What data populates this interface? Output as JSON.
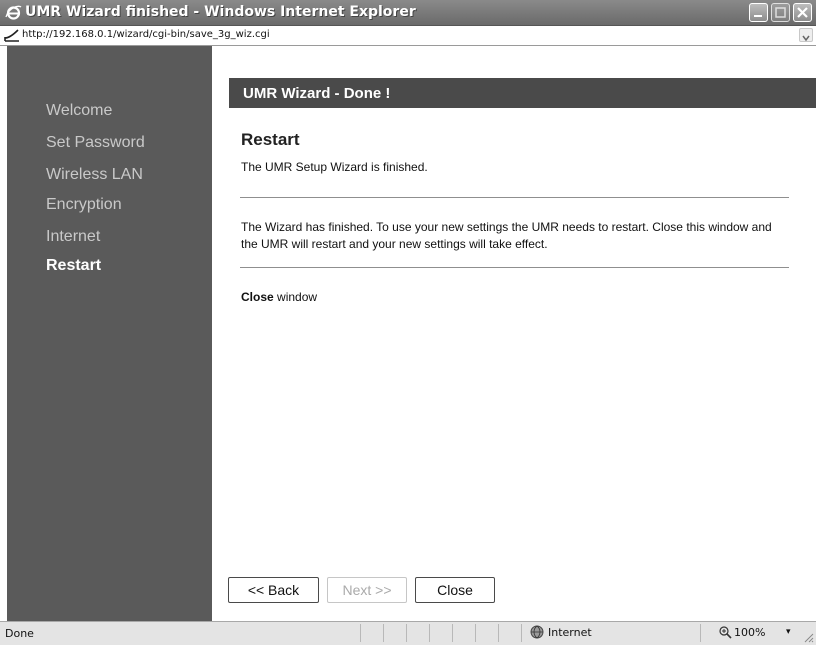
{
  "window": {
    "title": "UMR Wizard finished - Windows Internet Explorer"
  },
  "address": {
    "url": "http://192.168.0.1/wizard/cgi-bin/save_3g_wiz.cgi"
  },
  "sidebar": {
    "items": [
      {
        "label": "Welcome",
        "active": false
      },
      {
        "label": "Set Password",
        "active": false
      },
      {
        "label": "Wireless LAN",
        "active": false
      },
      {
        "label": "Encryption",
        "active": false
      },
      {
        "label": "Internet",
        "active": false
      },
      {
        "label": "Restart",
        "active": true
      }
    ]
  },
  "main": {
    "header": "UMR Wizard - Done !",
    "section_title": "Restart",
    "subtitle": "The UMR Setup Wizard is finished.",
    "body": "The Wizard has finished. To use your new settings the UMR needs to restart. Close this window and the UMR will restart and your new settings will take effect.",
    "close_window_bold": "Close",
    "close_window_rest": " window"
  },
  "buttons": {
    "back": "<< Back",
    "next": "Next >>",
    "close": "Close"
  },
  "statusbar": {
    "status": "Done",
    "zone": "Internet",
    "zoom": "100%",
    "zoom_arrow": "▾"
  },
  "icons": {
    "browser": "ie-logo-icon",
    "page": "page-icon",
    "zone": "globe-icon",
    "zoom": "magnifier-icon"
  },
  "colors": {
    "sidebar_bg": "#5a5a5a",
    "header_bg": "#4a4a4a",
    "titlebar": "#7a7a7a"
  }
}
